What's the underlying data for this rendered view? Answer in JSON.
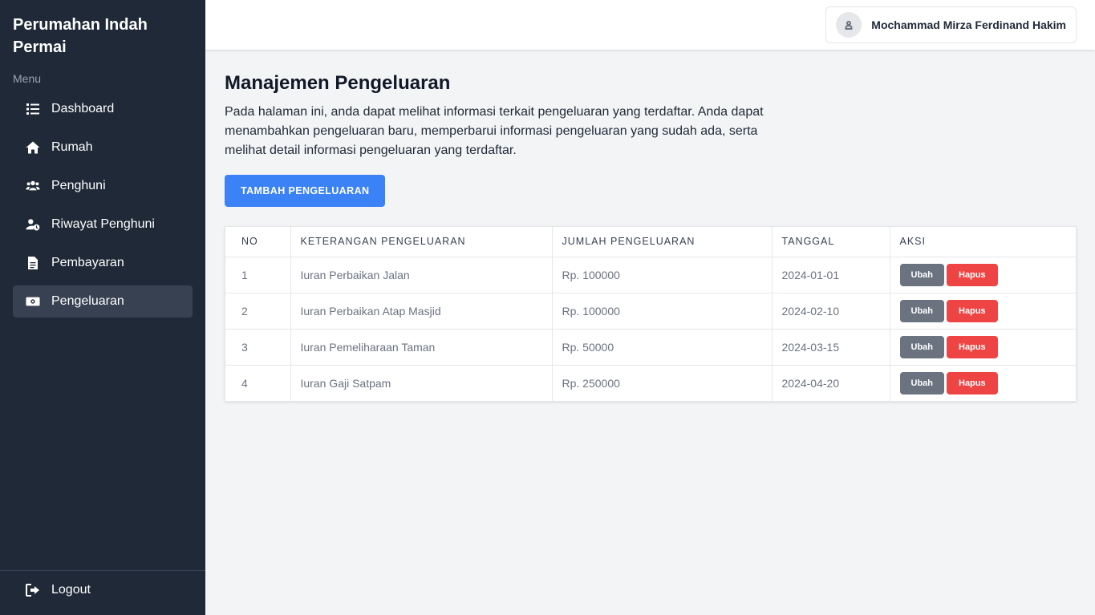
{
  "app": {
    "title": "Perumahan Indah Permai"
  },
  "sidebar": {
    "menu_label": "Menu",
    "items": [
      {
        "label": "Dashboard",
        "icon": "list-icon",
        "active": false
      },
      {
        "label": "Rumah",
        "icon": "home-icon",
        "active": false
      },
      {
        "label": "Penghuni",
        "icon": "users-icon",
        "active": false
      },
      {
        "label": "Riwayat Penghuni",
        "icon": "user-clock-icon",
        "active": false
      },
      {
        "label": "Pembayaran",
        "icon": "document-icon",
        "active": false
      },
      {
        "label": "Pengeluaran",
        "icon": "money-icon",
        "active": true
      }
    ],
    "logout_label": "Logout",
    "active_color": "#374151",
    "background_color": "#1f2937"
  },
  "header": {
    "user_name": "Mochammad Mirza Ferdinand Hakim"
  },
  "main": {
    "title": "Manajemen Pengeluaran",
    "description": "Pada halaman ini, anda dapat melihat informasi terkait pengeluaran yang terdaftar. Anda dapat menambahkan pengeluaran baru, memperbarui informasi pengeluaran yang sudah ada, serta melihat detail informasi pengeluaran yang terdaftar.",
    "add_button_label": "TAMBAH PENGELUARAN",
    "accent_color": "#3b82f6"
  },
  "table": {
    "columns": [
      "NO",
      "KETERANGAN PENGELUARAN",
      "JUMLAH PENGELUARAN",
      "TANGGAL",
      "AKSI"
    ],
    "rows": [
      {
        "no": "1",
        "keterangan": "Iuran Perbaikan Jalan",
        "jumlah": "Rp. 100000",
        "tanggal": "2024-01-01"
      },
      {
        "no": "2",
        "keterangan": "Iuran Perbaikan Atap Masjid",
        "jumlah": "Rp. 100000",
        "tanggal": "2024-02-10"
      },
      {
        "no": "3",
        "keterangan": "Iuran Pemeliharaan Taman",
        "jumlah": "Rp. 50000",
        "tanggal": "2024-03-15"
      },
      {
        "no": "4",
        "keterangan": "Iuran Gaji Satpam",
        "jumlah": "Rp. 250000",
        "tanggal": "2024-04-20"
      }
    ],
    "edit_label": "Ubah",
    "delete_label": "Hapus",
    "edit_color": "#6b7280",
    "delete_color": "#ef4444"
  }
}
